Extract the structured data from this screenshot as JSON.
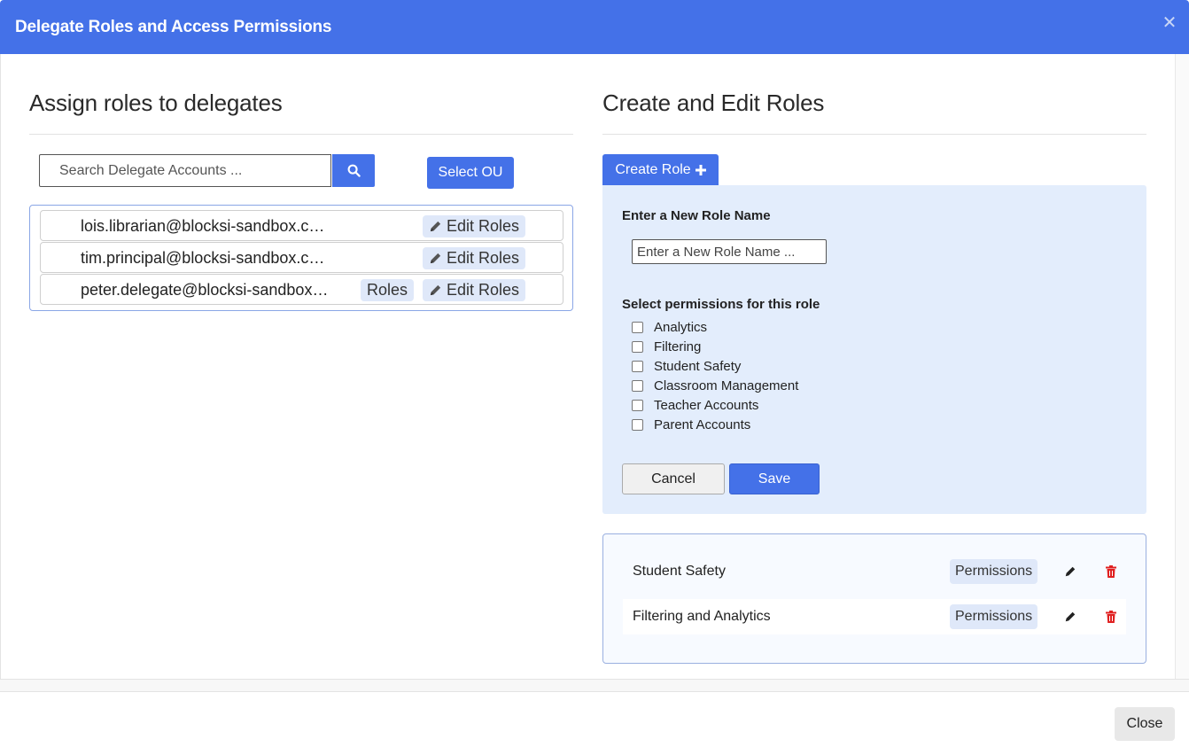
{
  "modal": {
    "title": "Delegate Roles and Access Permissions",
    "close_icon": "close-icon"
  },
  "left": {
    "title": "Assign roles to delegates",
    "search": {
      "placeholder": "Search Delegate Accounts ...",
      "value": ""
    },
    "select_ou_label": "Select OU",
    "delegates": [
      {
        "email": "lois.librarian@blocksi-sandbox.c…",
        "edit_label": "Edit Roles",
        "roles_label": null
      },
      {
        "email": "tim.principal@blocksi-sandbox.c…",
        "edit_label": "Edit Roles",
        "roles_label": null
      },
      {
        "email": "peter.delegate@blocksi-sandbox…",
        "edit_label": "Edit Roles",
        "roles_label": "Roles"
      }
    ]
  },
  "right": {
    "title": "Create and Edit Roles",
    "create_role_label": "Create Role",
    "new_role_label": "Enter a New Role Name",
    "new_role_placeholder": "Enter a New Role Name ...",
    "permissions_label": "Select permissions for this role",
    "permissions": [
      {
        "label": "Analytics",
        "checked": false
      },
      {
        "label": "Filtering",
        "checked": false
      },
      {
        "label": "Student Safety",
        "checked": false
      },
      {
        "label": "Classroom Management",
        "checked": false
      },
      {
        "label": "Teacher Accounts",
        "checked": false
      },
      {
        "label": "Parent Accounts",
        "checked": false
      }
    ],
    "cancel_label": "Cancel",
    "save_label": "Save",
    "roles": [
      {
        "name": "Student Safety",
        "permissions_label": "Permissions"
      },
      {
        "name": "Filtering and Analytics",
        "permissions_label": "Permissions"
      }
    ]
  },
  "footer": {
    "close_label": "Close"
  },
  "colors": {
    "primary": "#4471e8",
    "panel": "#e3edfc",
    "chip": "#dfe8f9",
    "delete": "#e02020"
  }
}
